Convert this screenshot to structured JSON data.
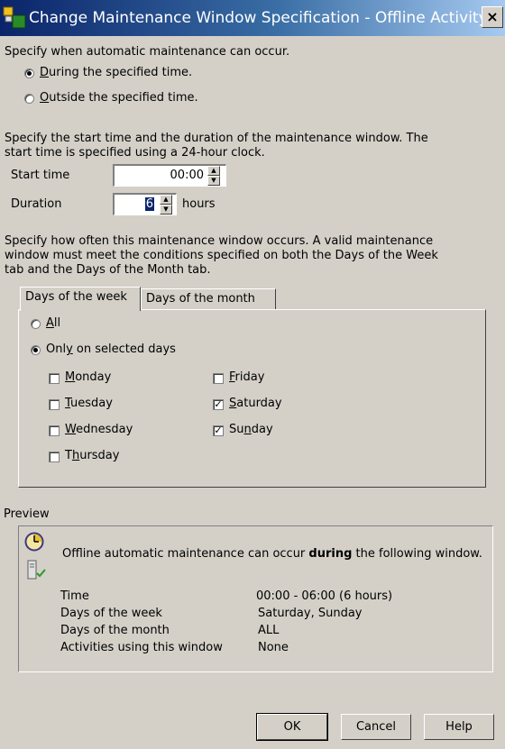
{
  "window": {
    "title": "Change Maintenance Window Specification - Offline Activity",
    "close_label": "×"
  },
  "when": {
    "prompt": "Specify when automatic maintenance can occur.",
    "options": [
      {
        "label": "During the specified time.",
        "mnemonic": "D",
        "rest": "uring the specified time.",
        "selected": true
      },
      {
        "label": "Outside the specified time.",
        "mnemonic": "O",
        "rest": "utside the specified time.",
        "selected": false
      }
    ]
  },
  "time": {
    "prompt_line1": "Specify the start time and the duration of the maintenance window. The",
    "prompt_line2": "start time is specified using a 24-hour clock.",
    "start_label": "Start time",
    "start_value": "00:00",
    "duration_label": "Duration",
    "duration_value": "6",
    "duration_unit": "hours"
  },
  "frequency": {
    "line1": "Specify how often this maintenance window occurs. A valid maintenance",
    "line2": "window must meet the conditions specified on both the Days of the Week",
    "line3": "tab and the Days of the Month tab."
  },
  "tabs": [
    {
      "label": "Days of the week",
      "active": true
    },
    {
      "label": "Days of the month",
      "active": false
    }
  ],
  "days_tab": {
    "all": {
      "mnemonic": "A",
      "rest": "ll",
      "selected": false
    },
    "only": {
      "before": "Onl",
      "mnemonic": "y",
      "rest": " on selected days",
      "selected": true
    },
    "days": [
      {
        "name": "Monday",
        "mnemonic": "M",
        "rest": "onday",
        "checked": false
      },
      {
        "name": "Tuesday",
        "mnemonic": "T",
        "rest": "uesday",
        "checked": false
      },
      {
        "name": "Wednesday",
        "mnemonic": "W",
        "rest": "ednesday",
        "checked": false
      },
      {
        "name": "Thursday",
        "before": "T",
        "mnemonic": "h",
        "rest": "ursday",
        "checked": false
      },
      {
        "name": "Friday",
        "mnemonic": "F",
        "rest": "riday",
        "checked": false
      },
      {
        "name": "Saturday",
        "mnemonic": "S",
        "rest": "aturday",
        "checked": true
      },
      {
        "name": "Sunday",
        "before": "Su",
        "mnemonic": "n",
        "rest": "day",
        "checked": true
      }
    ]
  },
  "preview": {
    "label": "Preview",
    "sentence_before": "Offline automatic maintenance can occur ",
    "sentence_bold": "during",
    "sentence_after": " the following window.",
    "rows": [
      {
        "label": "Time",
        "value": "00:00 - 06:00 (6 hours)"
      },
      {
        "label": "Days of the week",
        "value": "Saturday, Sunday"
      },
      {
        "label": "Days of the month",
        "value": "ALL"
      },
      {
        "label": "Activities using this window",
        "value": "None"
      }
    ]
  },
  "buttons": {
    "ok": "OK",
    "cancel": "Cancel",
    "help": "Help"
  },
  "icons": {
    "window": "maintenance-window-icon",
    "clock": "clock-icon",
    "device": "device-check-icon"
  }
}
